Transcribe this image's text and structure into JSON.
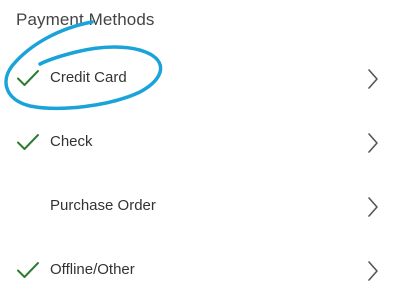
{
  "section": {
    "title": "Payment Methods"
  },
  "methods": [
    {
      "label": "Credit Card",
      "enabled": true,
      "check_icon": "checkmark-icon",
      "chevron_icon": "chevron-right-icon"
    },
    {
      "label": "Check",
      "enabled": true,
      "check_icon": "checkmark-icon",
      "chevron_icon": "chevron-right-icon"
    },
    {
      "label": "Purchase Order",
      "enabled": false,
      "check_icon": "",
      "chevron_icon": "chevron-right-icon"
    },
    {
      "label": "Offline/Other",
      "enabled": true,
      "check_icon": "checkmark-icon",
      "chevron_icon": "chevron-right-icon"
    }
  ],
  "colors": {
    "check": "#2e7d32",
    "chevron": "#555555",
    "annotation": "#1aa3d9"
  }
}
